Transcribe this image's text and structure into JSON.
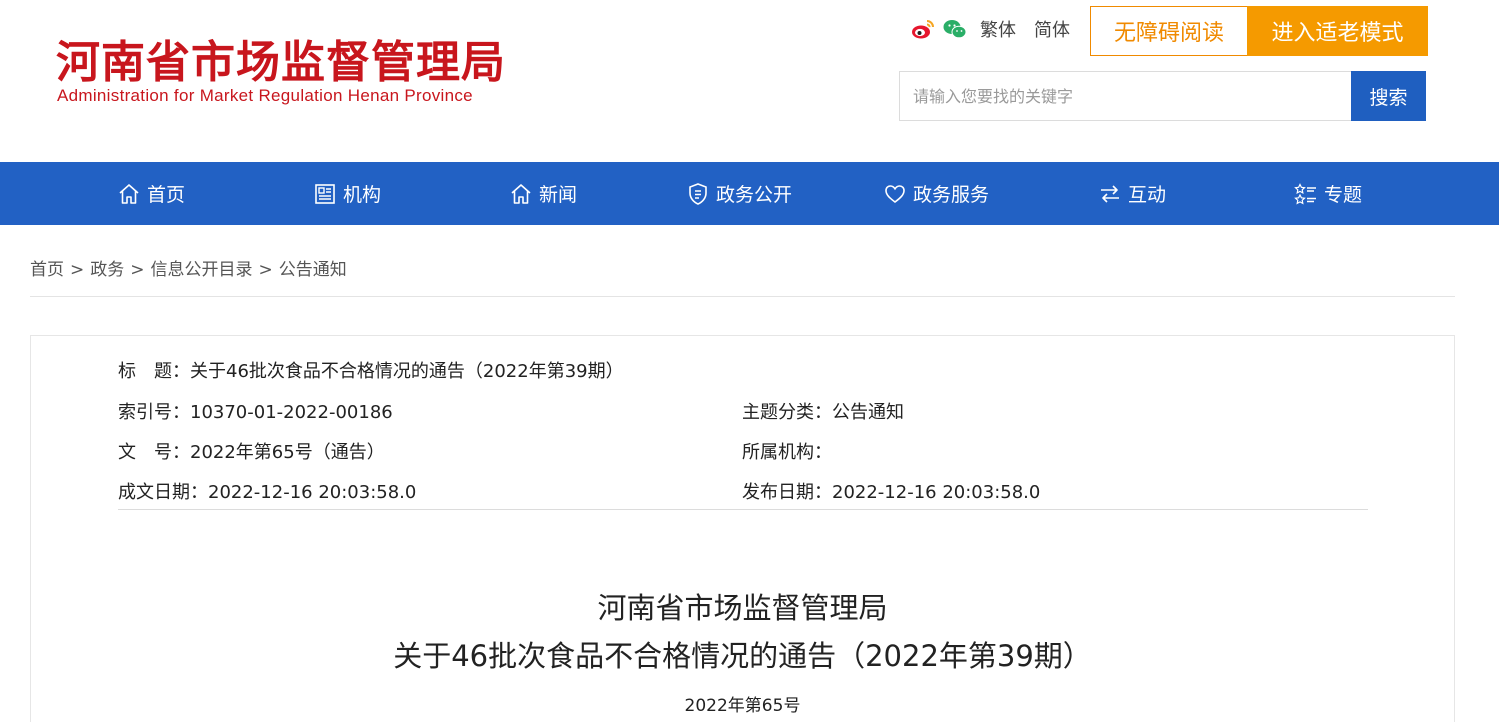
{
  "header": {
    "logo_cn": "河南省市场监督管理局",
    "logo_en": "Administration for Market Regulation Henan Province",
    "social_icons": [
      "weibo-icon",
      "wechat-icon"
    ],
    "lang_traditional": "繁体",
    "lang_simplified": "简体",
    "accessible_reading": "无障碍阅读",
    "elder_mode": "进入适老模式",
    "search_placeholder": "请输入您要找的关键字",
    "search_button": "搜索",
    "brand_color": "#c8161d",
    "accent_orange": "#f59a00"
  },
  "nav": {
    "background": "#2261c4",
    "items": [
      {
        "label": "首页",
        "icon": "home-icon"
      },
      {
        "label": "机构",
        "icon": "org-icon"
      },
      {
        "label": "新闻",
        "icon": "news-icon"
      },
      {
        "label": "政务公开",
        "icon": "shield-icon"
      },
      {
        "label": "政务服务",
        "icon": "heart-icon"
      },
      {
        "label": "互动",
        "icon": "exchange-icon"
      },
      {
        "label": "专题",
        "icon": "topic-icon"
      }
    ]
  },
  "breadcrumb": {
    "items": [
      "首页",
      "政务",
      "信息公开目录",
      "公告通知"
    ],
    "separator": ">"
  },
  "meta": {
    "title_label": "标　题：",
    "title_value": "关于46批次食品不合格情况的通告（2022年第39期）",
    "index_label": "索引号：",
    "index_value": "10370-01-2022-00186",
    "topic_label": "主题分类：",
    "topic_value": "公告通知",
    "docno_label": "文　号：",
    "docno_value": "2022年第65号（通告）",
    "org_label": "所属机构：",
    "org_value": "",
    "created_label": "成文日期：",
    "created_value": "2022-12-16 20:03:58.0",
    "published_label": "发布日期：",
    "published_value": "2022-12-16 20:03:58.0"
  },
  "document": {
    "heading_line1": "河南省市场监督管理局",
    "heading_line2": "关于46批次食品不合格情况的通告（2022年第39期）",
    "number": "2022年第65号"
  }
}
